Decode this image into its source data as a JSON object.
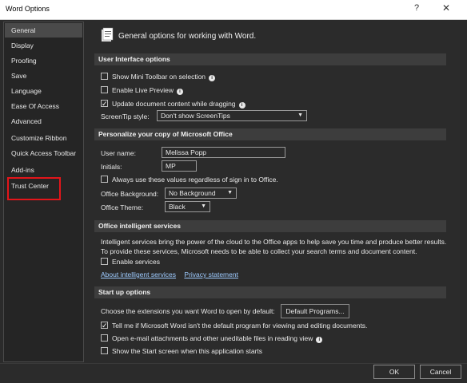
{
  "window": {
    "title": "Word Options",
    "help": "?",
    "close": "✕"
  },
  "sidebar": {
    "items": [
      {
        "label": "General",
        "selected": true
      },
      {
        "label": "Display"
      },
      {
        "label": "Proofing"
      },
      {
        "label": "Save"
      },
      {
        "label": "Language"
      },
      {
        "label": "Ease Of Access"
      },
      {
        "label": "Advanced"
      },
      {
        "label": "Customize Ribbon"
      },
      {
        "label": "Quick Access Toolbar"
      },
      {
        "label": "Add-ins"
      },
      {
        "label": "Trust Center",
        "highlighted": true
      }
    ]
  },
  "header": {
    "text": "General options for working with Word."
  },
  "ui_options": {
    "title": "User Interface options",
    "mini_toolbar": "Show Mini Toolbar on selection",
    "live_preview": "Enable Live Preview",
    "update_dragging": "Update document content while dragging",
    "screentip_label": "ScreenTip style:",
    "screentip_value": "Don't show ScreenTips"
  },
  "personalize": {
    "title": "Personalize your copy of Microsoft Office",
    "username_label": "User name:",
    "username_value": "Melissa Popp",
    "initials_label": "Initials:",
    "initials_value": "MP",
    "always_use": "Always use these values regardless of sign in to Office.",
    "background_label": "Office Background:",
    "background_value": "No Background",
    "theme_label": "Office Theme:",
    "theme_value": "Black"
  },
  "intelligent": {
    "title": "Office intelligent services",
    "description": "Intelligent services bring the power of the cloud to the Office apps to help save you time and produce better results. To provide these services, Microsoft needs to be able to collect your search terms and document content.",
    "enable": "Enable services",
    "about_link": "About intelligent services",
    "privacy_link": "Privacy statement"
  },
  "startup": {
    "title": "Start up options",
    "choose_ext": "Choose the extensions you want Word to open by default:",
    "default_programs": "Default Programs...",
    "tell_me": "Tell me if Microsoft Word isn't the default program for viewing and editing documents.",
    "open_email": "Open e-mail attachments and other uneditable files in reading view",
    "show_start": "Show the Start screen when this application starts"
  },
  "footer": {
    "ok": "OK",
    "cancel": "Cancel"
  },
  "icons": {
    "header": "word-options-general-icon",
    "info": "info-icon",
    "dropdown": "chevron-down-icon"
  }
}
